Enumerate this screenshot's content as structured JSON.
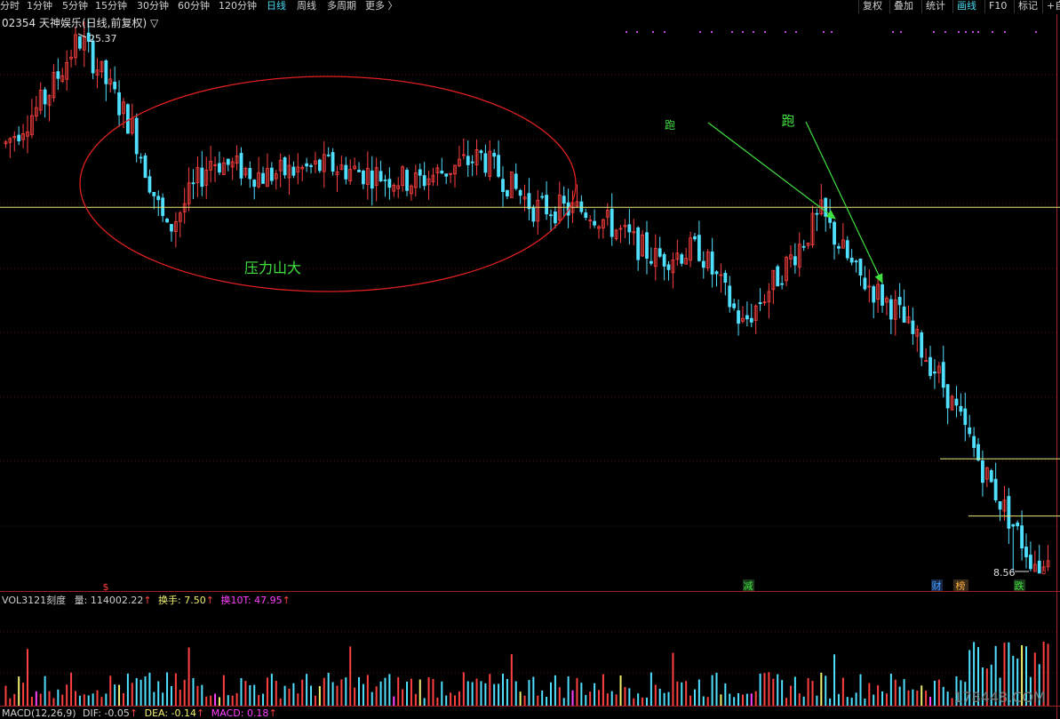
{
  "toolbar": {
    "periods": [
      "分时",
      "1分钟",
      "5分钟",
      "15分钟",
      "30分钟",
      "60分钟",
      "120分钟",
      "日线",
      "周线",
      "多周期",
      "更多 〉"
    ],
    "active_period": "日线",
    "right_buttons": [
      "复权",
      "叠加",
      "统计",
      "画线",
      "F10",
      "标记",
      "+自"
    ],
    "active_right": "画线"
  },
  "stock": {
    "title": "02354 天神娱乐(日线,前复权) ▽",
    "high_label": "25.37",
    "low_label": "8.56"
  },
  "annotations": {
    "ellipse_label": "压力山大",
    "run_label_1": "跑",
    "run_label_2": "跑"
  },
  "event_marks": {
    "s_mark": "$",
    "jian": "减",
    "cai": "财",
    "bang": "榜",
    "die": "跌"
  },
  "volume_header": {
    "name": "VOL3121刻度",
    "vol_label": "量: 114002.22",
    "turnover_label": "换手: 7.50",
    "turnover10_label": "换10T: 47.95"
  },
  "macd_header": {
    "name": "MACD(12,26,9)",
    "dif_label": "DIF: -0.05",
    "dea_label": "DEA: -0.14",
    "macd_label": "MACD: 0.18"
  },
  "watermark": "178448.COM",
  "colors": {
    "up": "#ff4040",
    "down": "#50e0ff",
    "hline": "#e8e87a",
    "ellipse": "#e02020",
    "arrow": "#40e040",
    "vol_yellow": "#f0f070",
    "vol_magenta": "#ff40ff"
  },
  "chart_data": {
    "type": "candlestick",
    "y_range": [
      8.56,
      25.37
    ],
    "support_price": 20.0,
    "close_trend": [
      {
        "day": 1,
        "close": 22.0
      },
      {
        "day": 10,
        "close": 23.4
      },
      {
        "day": 18,
        "close": 25.37
      },
      {
        "day": 30,
        "close": 22.5
      },
      {
        "day": 38,
        "close": 19.2
      },
      {
        "day": 48,
        "close": 21.5
      },
      {
        "day": 60,
        "close": 21.0
      },
      {
        "day": 75,
        "close": 21.3
      },
      {
        "day": 95,
        "close": 20.8
      },
      {
        "day": 110,
        "close": 21.6
      },
      {
        "day": 122,
        "close": 20.0
      },
      {
        "day": 135,
        "close": 19.9
      },
      {
        "day": 150,
        "close": 18.4
      },
      {
        "day": 160,
        "close": 18.7
      },
      {
        "day": 170,
        "close": 16.3
      },
      {
        "day": 180,
        "close": 18.2
      },
      {
        "day": 188,
        "close": 19.8
      },
      {
        "day": 196,
        "close": 17.9
      },
      {
        "day": 205,
        "close": 16.8
      },
      {
        "day": 215,
        "close": 14.7
      },
      {
        "day": 225,
        "close": 11.8
      },
      {
        "day": 236,
        "close": 9.0
      },
      {
        "day": 240,
        "close": 8.56
      }
    ]
  }
}
